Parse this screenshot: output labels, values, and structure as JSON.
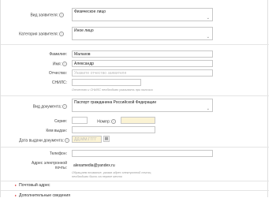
{
  "applicant_type": {
    "label": "Вид заявителя:",
    "value": "Физическое лицо"
  },
  "applicant_category": {
    "label": "Категория заявителя:",
    "value": "Иное лицо"
  },
  "last_name": {
    "label": "Фамилия:",
    "value": "Малахов"
  },
  "first_name": {
    "label": "Имя:",
    "value": "Александр"
  },
  "patronymic": {
    "label": "Отчество:",
    "placeholder": "Укажите отчество заявителя"
  },
  "snils": {
    "label": "СНИЛС:",
    "value": "",
    "hint": "Отчество и СНИЛС необходимо указывать при наличии"
  },
  "document_type": {
    "label": "Вид документа:",
    "value": "Паспорт гражданина Российской Федерации"
  },
  "series": {
    "label": "Серия:",
    "value": ""
  },
  "number": {
    "label": "Номер:",
    "value": ""
  },
  "issued_by": {
    "label": "Кем выдан:",
    "value": ""
  },
  "issue_date": {
    "label": "Дата выдачи документа:",
    "placeholder": "ДД.ММ.ГГГГ"
  },
  "phone": {
    "label": "Телефон:",
    "value": ""
  },
  "email": {
    "label_line1": "Адрес электронной",
    "label_line2": "почты:",
    "value": "alexamedia@yandex.ru",
    "hint_line1": "Обращаем внимание, указав адрес электронной почты,",
    "hint_line2": "необходимо быть на первое место"
  },
  "sections": {
    "postal_address": "Почтовый адрес",
    "additional": "Дополнительные сведения"
  }
}
